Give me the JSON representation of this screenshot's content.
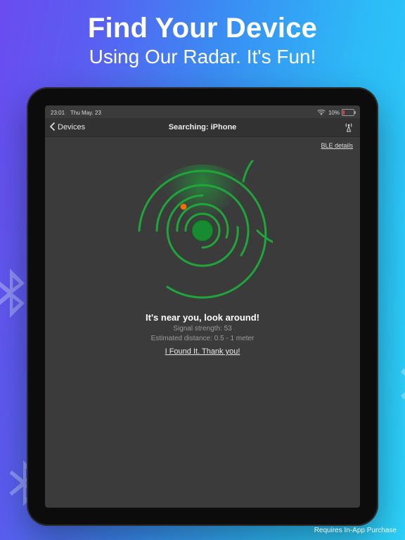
{
  "hero": {
    "title": "Find Your Device",
    "subtitle": "Using Our Radar. It's Fun!"
  },
  "statusbar": {
    "time": "23:01",
    "date": "Thu May. 23",
    "battery_pct": "10%"
  },
  "nav": {
    "back_label": "Devices",
    "title": "Searching: iPhone"
  },
  "ble_link": "BLE details",
  "radar": {
    "ring_color": "#1ea63b",
    "center_color": "#188a2f",
    "blip_color": "#ff6a00",
    "sweep_angle_deg": 315
  },
  "info": {
    "near_text": "It's near you, look around!",
    "signal_label": "Signal strength: 53",
    "distance_label": "Estimated distance: 0.5 - 1 meter",
    "found_link": "I Found It. Thank you!"
  },
  "footer": {
    "iap_note": "Requires In-App Purchase"
  }
}
